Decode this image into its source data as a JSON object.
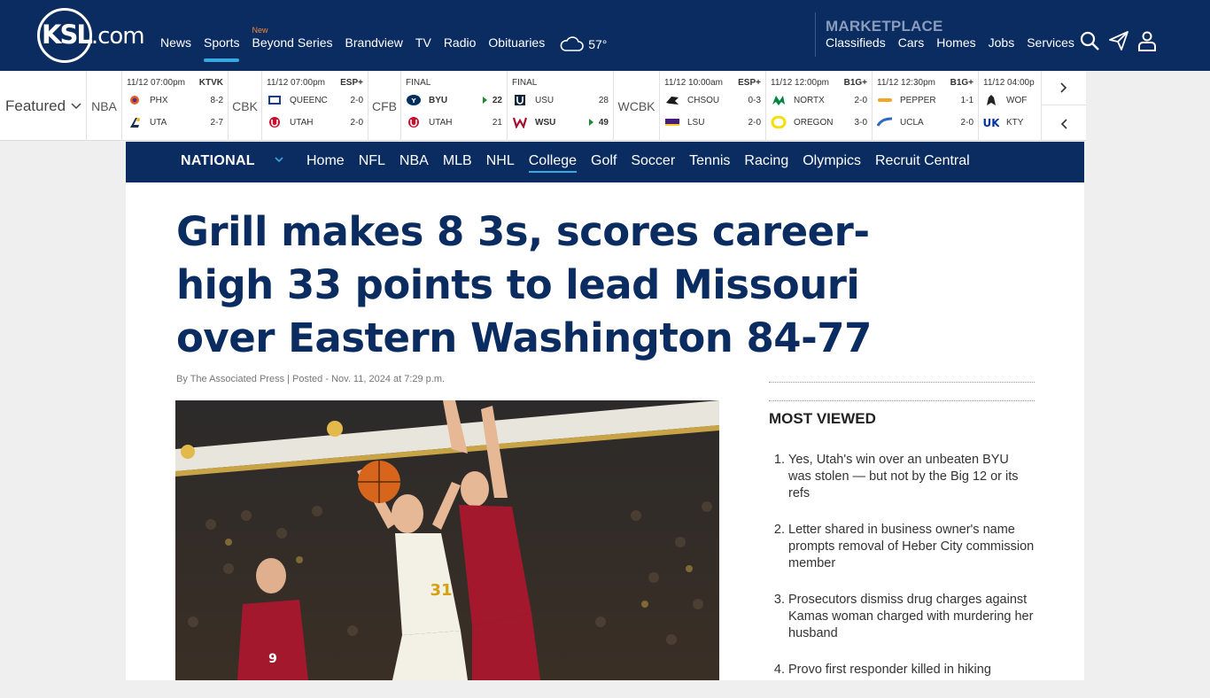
{
  "topnav": {
    "logo": {
      "brand": "KSL",
      "suffix": ".com"
    },
    "links": [
      {
        "label": "News",
        "active": false
      },
      {
        "label": "Sports",
        "active": true
      },
      {
        "label": "Beyond Series",
        "tag": "New",
        "active": false
      },
      {
        "label": "Brandview",
        "active": false
      },
      {
        "label": "TV",
        "active": false
      },
      {
        "label": "Radio",
        "active": false
      },
      {
        "label": "Obituaries",
        "active": false
      }
    ],
    "weather": {
      "icon": "cloud-icon",
      "temp": "57°"
    },
    "marketplace": {
      "title": "MARKETPLACE",
      "links": [
        "Classifieds",
        "Cars",
        "Homes",
        "Jobs",
        "Services"
      ]
    },
    "icons": [
      "search-icon",
      "send-icon",
      "account-icon"
    ],
    "colors": {
      "bg": "#0b2c60",
      "accent": "#36a9e1",
      "new_tag": "#f08a3c"
    }
  },
  "scoreboard": {
    "featured_label": "Featured",
    "leagues": [
      "NBA",
      "CBK",
      "CFB",
      "WCBK"
    ],
    "games": [
      {
        "time": "11/12 07:00pm",
        "network": "KTVK",
        "teams": [
          {
            "name": "PHX",
            "score": "8-2"
          },
          {
            "name": "UTA",
            "score": "2-7"
          }
        ]
      },
      {
        "time": "11/12 07:00pm",
        "network": "ESP+",
        "teams": [
          {
            "name": "QUEENC",
            "score": "2-0"
          },
          {
            "name": "UTAH",
            "score": "2-0"
          }
        ]
      },
      {
        "time": "FINAL",
        "network": "",
        "teams": [
          {
            "name": "BYU",
            "score": "22",
            "winner": true
          },
          {
            "name": "UTAH",
            "score": "21"
          }
        ]
      },
      {
        "time": "FINAL",
        "network": "",
        "teams": [
          {
            "name": "USU",
            "score": "28"
          },
          {
            "name": "WSU",
            "score": "49",
            "winner": true
          }
        ]
      },
      {
        "time": "11/12 10:00am",
        "network": "ESP+",
        "teams": [
          {
            "name": "CHSOU",
            "score": "0-3"
          },
          {
            "name": "LSU",
            "score": "2-0"
          }
        ]
      },
      {
        "time": "11/12 12:00pm",
        "network": "B1G+",
        "teams": [
          {
            "name": "NORTX",
            "score": "2-0"
          },
          {
            "name": "OREGON",
            "score": "3-0"
          }
        ]
      },
      {
        "time": "11/12 12:30pm",
        "network": "B1G+",
        "teams": [
          {
            "name": "PEPPER",
            "score": "1-1"
          },
          {
            "name": "UCLA",
            "score": "2-0"
          }
        ]
      },
      {
        "time": "11/12 04:00p",
        "network": "",
        "teams": [
          {
            "name": "WOF",
            "score": ""
          },
          {
            "name": "KTY",
            "score": ""
          }
        ]
      }
    ]
  },
  "subnav": {
    "section": "NATIONAL",
    "links": [
      {
        "label": "Home",
        "active": false
      },
      {
        "label": "NFL",
        "active": false
      },
      {
        "label": "NBA",
        "active": false
      },
      {
        "label": "MLB",
        "active": false
      },
      {
        "label": "NHL",
        "active": false
      },
      {
        "label": "College",
        "active": true
      },
      {
        "label": "Golf",
        "active": false
      },
      {
        "label": "Soccer",
        "active": false
      },
      {
        "label": "Tennis",
        "active": false
      },
      {
        "label": "Racing",
        "active": false
      },
      {
        "label": "Olympics",
        "active": false
      },
      {
        "label": "Recruit Central",
        "active": false
      }
    ]
  },
  "article": {
    "headline": "Grill makes 8 3s, scores career-high 33 points to lead Missouri over Eastern Washington 84-77",
    "byline": "By The Associated Press | Posted - Nov. 11, 2024 at 7:29 p.m."
  },
  "most_viewed": {
    "title": "MOST VIEWED",
    "items": [
      {
        "num": "1.",
        "text": "Yes, Utah's win over an unbeaten BYU was stolen — but not by the Big 12 or its refs"
      },
      {
        "num": "2.",
        "text": "Letter shared in business owner's name prompts removal of Heber City commission member"
      },
      {
        "num": "3.",
        "text": "Prosecutors dismiss drug charges against Kamas woman charged with murdering her husband"
      },
      {
        "num": "4.",
        "text": "Provo first responder killed in hiking"
      }
    ]
  }
}
